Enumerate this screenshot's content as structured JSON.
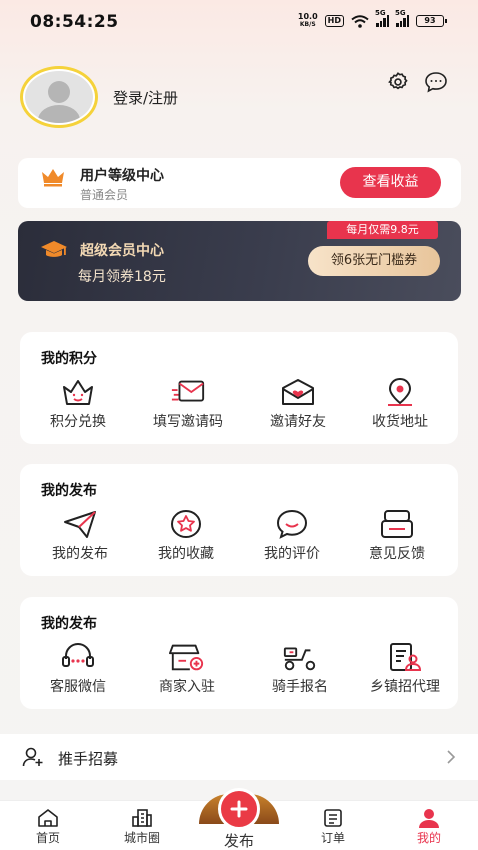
{
  "status_bar": {
    "time": "08:54:25",
    "net_speed_value": "10.0",
    "net_speed_unit": "KB/S",
    "hd": "HD",
    "signal_tag_1": "5G",
    "signal_tag_2": "5G",
    "battery": "93"
  },
  "header": {
    "login_label": "登录/注册",
    "avatar_border_color": "#f5d23a"
  },
  "level_card": {
    "title": "用户等级中心",
    "subtitle": "普通会员",
    "button": "查看收益"
  },
  "vip_card": {
    "title": "超级会员中心",
    "subtitle": "每月领券18元",
    "badge": "每月仅需9.8元",
    "button": "领6张无门槛券"
  },
  "sections": [
    {
      "title": "我的积分",
      "items": [
        {
          "label": "积分兑换",
          "icon": "crown-smile-icon"
        },
        {
          "label": "填写邀请码",
          "icon": "mail-send-icon"
        },
        {
          "label": "邀请好友",
          "icon": "envelope-heart-icon"
        },
        {
          "label": "收货地址",
          "icon": "location-pin-icon"
        }
      ]
    },
    {
      "title": "我的发布",
      "items": [
        {
          "label": "我的发布",
          "icon": "paper-plane-icon"
        },
        {
          "label": "我的收藏",
          "icon": "star-circle-icon"
        },
        {
          "label": "我的评价",
          "icon": "smile-bubble-icon"
        },
        {
          "label": "意见反馈",
          "icon": "feedback-box-icon"
        }
      ]
    },
    {
      "title": "我的发布",
      "items": [
        {
          "label": "客服微信",
          "icon": "headset-chat-icon"
        },
        {
          "label": "商家入驻",
          "icon": "shop-add-icon"
        },
        {
          "label": "骑手报名",
          "icon": "scooter-icon"
        },
        {
          "label": "乡镇招代理",
          "icon": "document-user-icon"
        }
      ]
    }
  ],
  "recruit": {
    "label": "推手招募"
  },
  "nav": {
    "items": [
      {
        "label": "首页",
        "icon": "home-icon"
      },
      {
        "label": "城市圈",
        "icon": "city-icon"
      },
      {
        "label": "发布",
        "icon": "plus-icon"
      },
      {
        "label": "订单",
        "icon": "order-icon"
      },
      {
        "label": "我的",
        "icon": "user-icon"
      }
    ],
    "active": "我的"
  },
  "colors": {
    "accent": "#e8344d",
    "vip_gold": "#f3d9b4",
    "crown_orange": "#f08a2a"
  }
}
